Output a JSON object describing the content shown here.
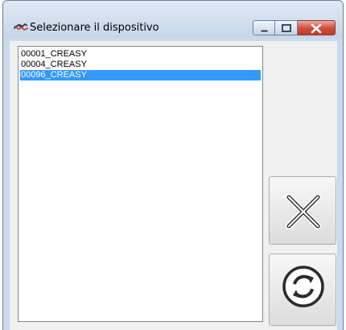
{
  "window": {
    "title": "Selezionare il dispositivo",
    "icon": "device-plug-icon"
  },
  "caption_buttons": {
    "minimize_icon": "minimize-icon",
    "maximize_icon": "maximize-icon",
    "close_icon": "close-icon"
  },
  "device_list": {
    "items": [
      {
        "label": "00001_CREASY",
        "selected": false
      },
      {
        "label": "00004_CREASY",
        "selected": false
      },
      {
        "label": "00096_CREASY",
        "selected": true
      }
    ]
  },
  "buttons": {
    "cancel_icon": "x-cancel-icon",
    "refresh_icon": "refresh-icon"
  },
  "colors": {
    "selection": "#3399ff",
    "close_button": "#c0392b"
  }
}
